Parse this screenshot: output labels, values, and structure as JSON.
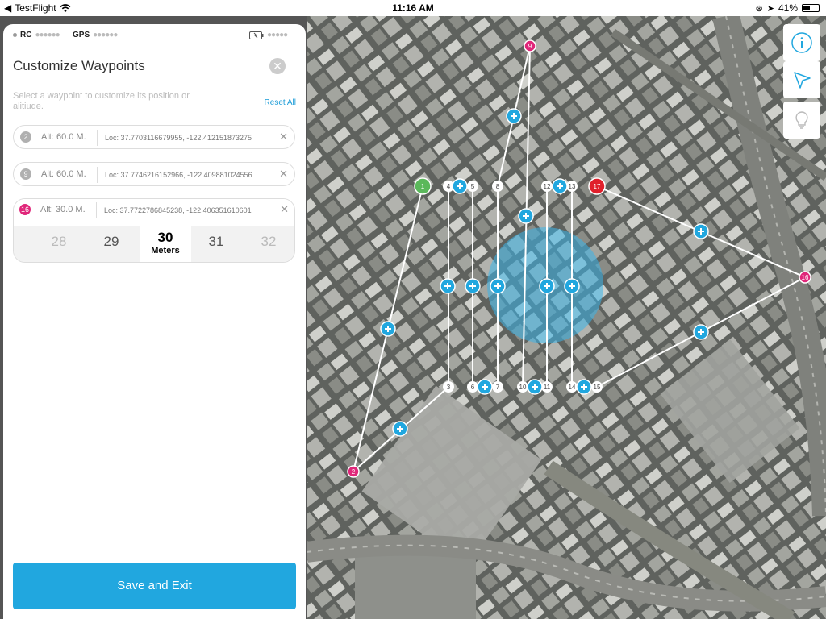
{
  "status_bar": {
    "back_app": "TestFlight",
    "time": "11:16 AM",
    "battery": "41%",
    "battery_fraction": 0.41
  },
  "signal": {
    "rc_label": "RC",
    "gps_label": "GPS"
  },
  "panel": {
    "title": "Customize Waypoints",
    "hint": "Select a waypoint to customize its position or alitiude.",
    "reset_label": "Reset All",
    "save_label": "Save and Exit"
  },
  "waypoints": [
    {
      "number": "2",
      "badge_color": "#b0b0b0",
      "alt": "Alt: 60.0 M.",
      "loc": "Loc: 37.7703116679955, -122.412151873275"
    },
    {
      "number": "9",
      "badge_color": "#b0b0b0",
      "alt": "Alt: 60.0 M.",
      "loc": "Loc: 37.7746216152966, -122.409881024556"
    }
  ],
  "selected_waypoint": {
    "number": "16",
    "badge_color": "#e0277a",
    "alt": "Alt: 30.0 M.",
    "loc": "Loc: 37.7722786845238, -122.406351610601",
    "picker": [
      "28",
      "29",
      "30",
      "31",
      "32"
    ],
    "selected_value": "30",
    "unit": "Meters"
  },
  "map_markers": {
    "start": "1",
    "end": "17",
    "numbers": [
      "2",
      "3",
      "4",
      "5",
      "6",
      "7",
      "8",
      "9",
      "10",
      "11",
      "12",
      "13",
      "14",
      "15",
      "16"
    ]
  },
  "colors": {
    "accent": "#21a7df",
    "start_marker": "#5bb85b",
    "end_marker": "#e0202b",
    "magenta_marker": "#e0277a"
  }
}
